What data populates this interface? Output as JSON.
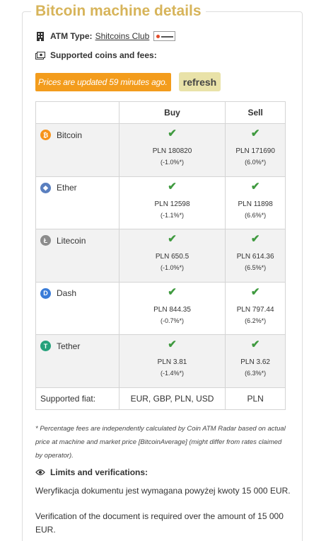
{
  "section": {
    "title": "Bitcoin machine details"
  },
  "atm": {
    "type_label": "ATM Type:",
    "type_value": "Shitcoins Club"
  },
  "coins_fees_label": "Supported coins and fees:",
  "update": {
    "message": "Prices are updated 59 minutes ago.",
    "refresh_label": "refresh"
  },
  "table": {
    "headers": [
      "",
      "Buy",
      "Sell"
    ],
    "rows": [
      {
        "name": "Bitcoin",
        "icon": "bitcoin-icon",
        "color": "#f7931a",
        "buy_price": "PLN 180820",
        "buy_pct": "(-1.0%*)",
        "sell_price": "PLN 171690",
        "sell_pct": "(6.0%*)"
      },
      {
        "name": "Ether",
        "icon": "ether-icon",
        "color": "#5a7fbf",
        "buy_price": "PLN 12598",
        "buy_pct": "(-1.1%*)",
        "sell_price": "PLN 11898",
        "sell_pct": "(6.6%*)"
      },
      {
        "name": "Litecoin",
        "icon": "litecoin-icon",
        "color": "#8c8c8c",
        "buy_price": "PLN 650.5",
        "buy_pct": "(-1.0%*)",
        "sell_price": "PLN 614.36",
        "sell_pct": "(6.5%*)"
      },
      {
        "name": "Dash",
        "icon": "dash-icon",
        "color": "#3a7cd8",
        "buy_price": "PLN 844.35",
        "buy_pct": "(-0.7%*)",
        "sell_price": "PLN 797.44",
        "sell_pct": "(6.2%*)"
      },
      {
        "name": "Tether",
        "icon": "tether-icon",
        "color": "#26a17b",
        "buy_price": "PLN 3.81",
        "buy_pct": "(-1.4%*)",
        "sell_price": "PLN 3.62",
        "sell_pct": "(6.3%*)"
      }
    ],
    "fiat": {
      "label": "Supported fiat:",
      "buy": "EUR, GBP, PLN, USD",
      "sell": "PLN"
    }
  },
  "note": "* Percentage fees are independently calculated by Coin ATM Radar based on actual price at machine and market price [BitcoinAverage] (might differ from rates claimed by operator).",
  "limits": {
    "title": "Limits and verifications:",
    "text_pl": "Weryfikacja dokumentu jest wymagana powyżej kwoty 15 000 EUR.",
    "text_en": "Verification of the document is required over the amount of 15 000 EUR."
  }
}
